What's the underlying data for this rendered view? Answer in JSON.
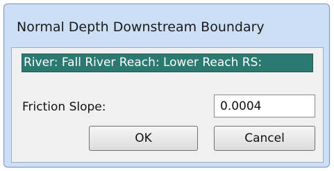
{
  "dialog": {
    "title": "Normal Depth Downstream Boundary",
    "location": "River: Fall River  Reach: Lower Reach  RS:",
    "friction_slope_label": "Friction Slope:",
    "friction_slope_value": "0.0004",
    "ok_label": "OK",
    "cancel_label": "Cancel"
  }
}
